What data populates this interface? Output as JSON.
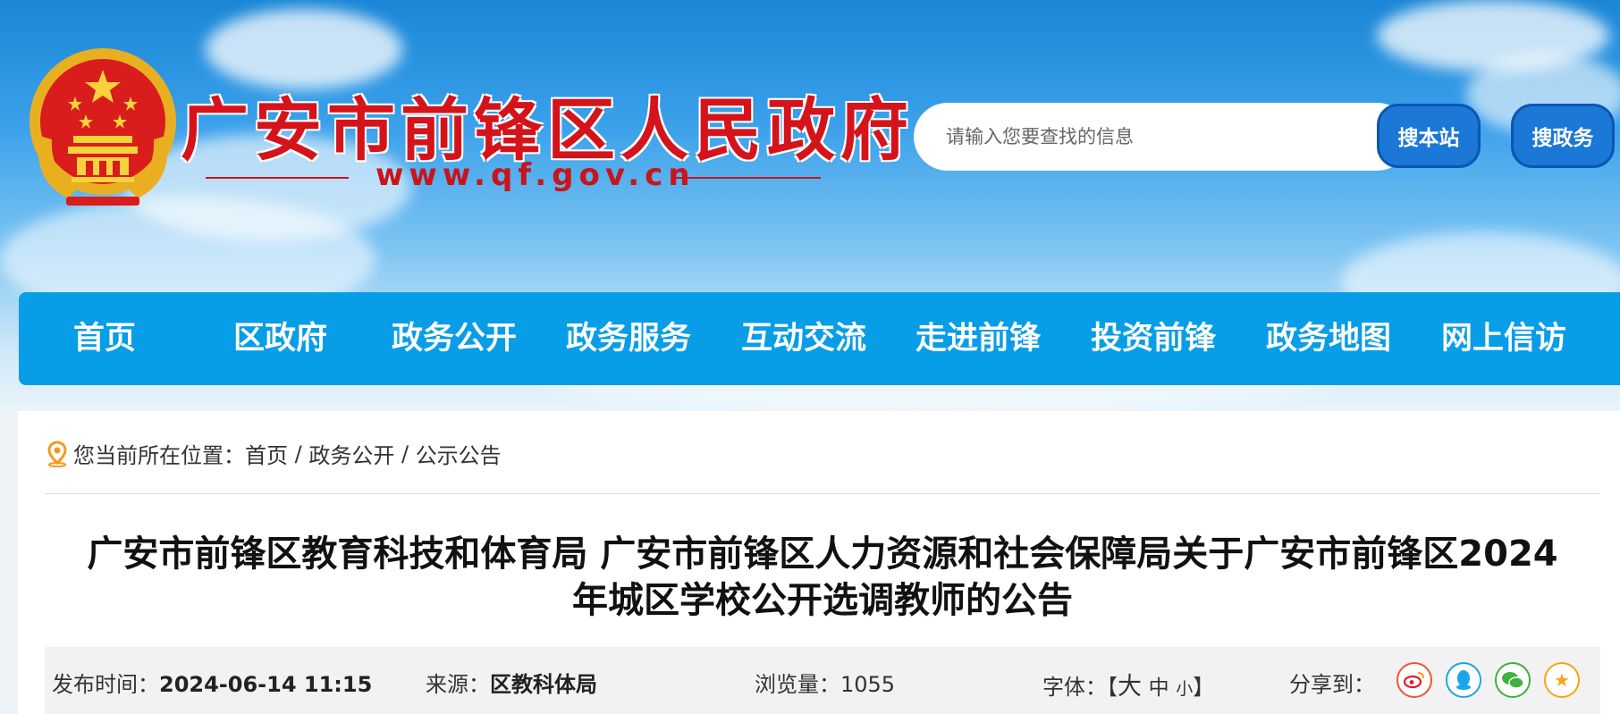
{
  "header": {
    "site_title": "广安市前锋区人民政府",
    "site_url": "www.qf.gov.cn",
    "search_placeholder": "请输入您要查找的信息",
    "search_site_label": "搜本站",
    "search_gov_label": "搜政务"
  },
  "nav": {
    "items": [
      {
        "label": "首页"
      },
      {
        "label": "区政府"
      },
      {
        "label": "政务公开"
      },
      {
        "label": "政务服务"
      },
      {
        "label": "互动交流"
      },
      {
        "label": "走进前锋"
      },
      {
        "label": "投资前锋"
      },
      {
        "label": "政务地图"
      },
      {
        "label": "网上信访"
      }
    ]
  },
  "breadcrumb": {
    "prefix": "您当前所在位置：",
    "items": [
      "首页",
      "政务公开",
      "公示公告"
    ],
    "separator": " / "
  },
  "article": {
    "title_line1": "广安市前锋区教育科技和体育局 广安市前锋区人力资源和社会保障局关于广安市前锋区2024",
    "title_line2": "年城区学校公开选调教师的公告",
    "publish_label": "发布时间：",
    "publish_time": "2024-06-14 11:15",
    "source_label": "来源：",
    "source": "区教科体局",
    "views_label": "浏览量：",
    "views": "1055",
    "font_label": "字体：",
    "font_open": "【",
    "font_large": "大",
    "font_medium": "中",
    "font_small": "小",
    "font_close": "】",
    "share_label": "分享到：",
    "share_icons": [
      "weibo-icon",
      "qq-icon",
      "wechat-icon",
      "favorite-icon"
    ]
  },
  "colors": {
    "nav_bg": "#089de7",
    "title_red": "#d4141a",
    "search_btn": "#1b78d6",
    "weibo": "#e6162d",
    "qq": "#1aa6e8",
    "wechat": "#3db33b",
    "favorite": "#f2a516"
  }
}
